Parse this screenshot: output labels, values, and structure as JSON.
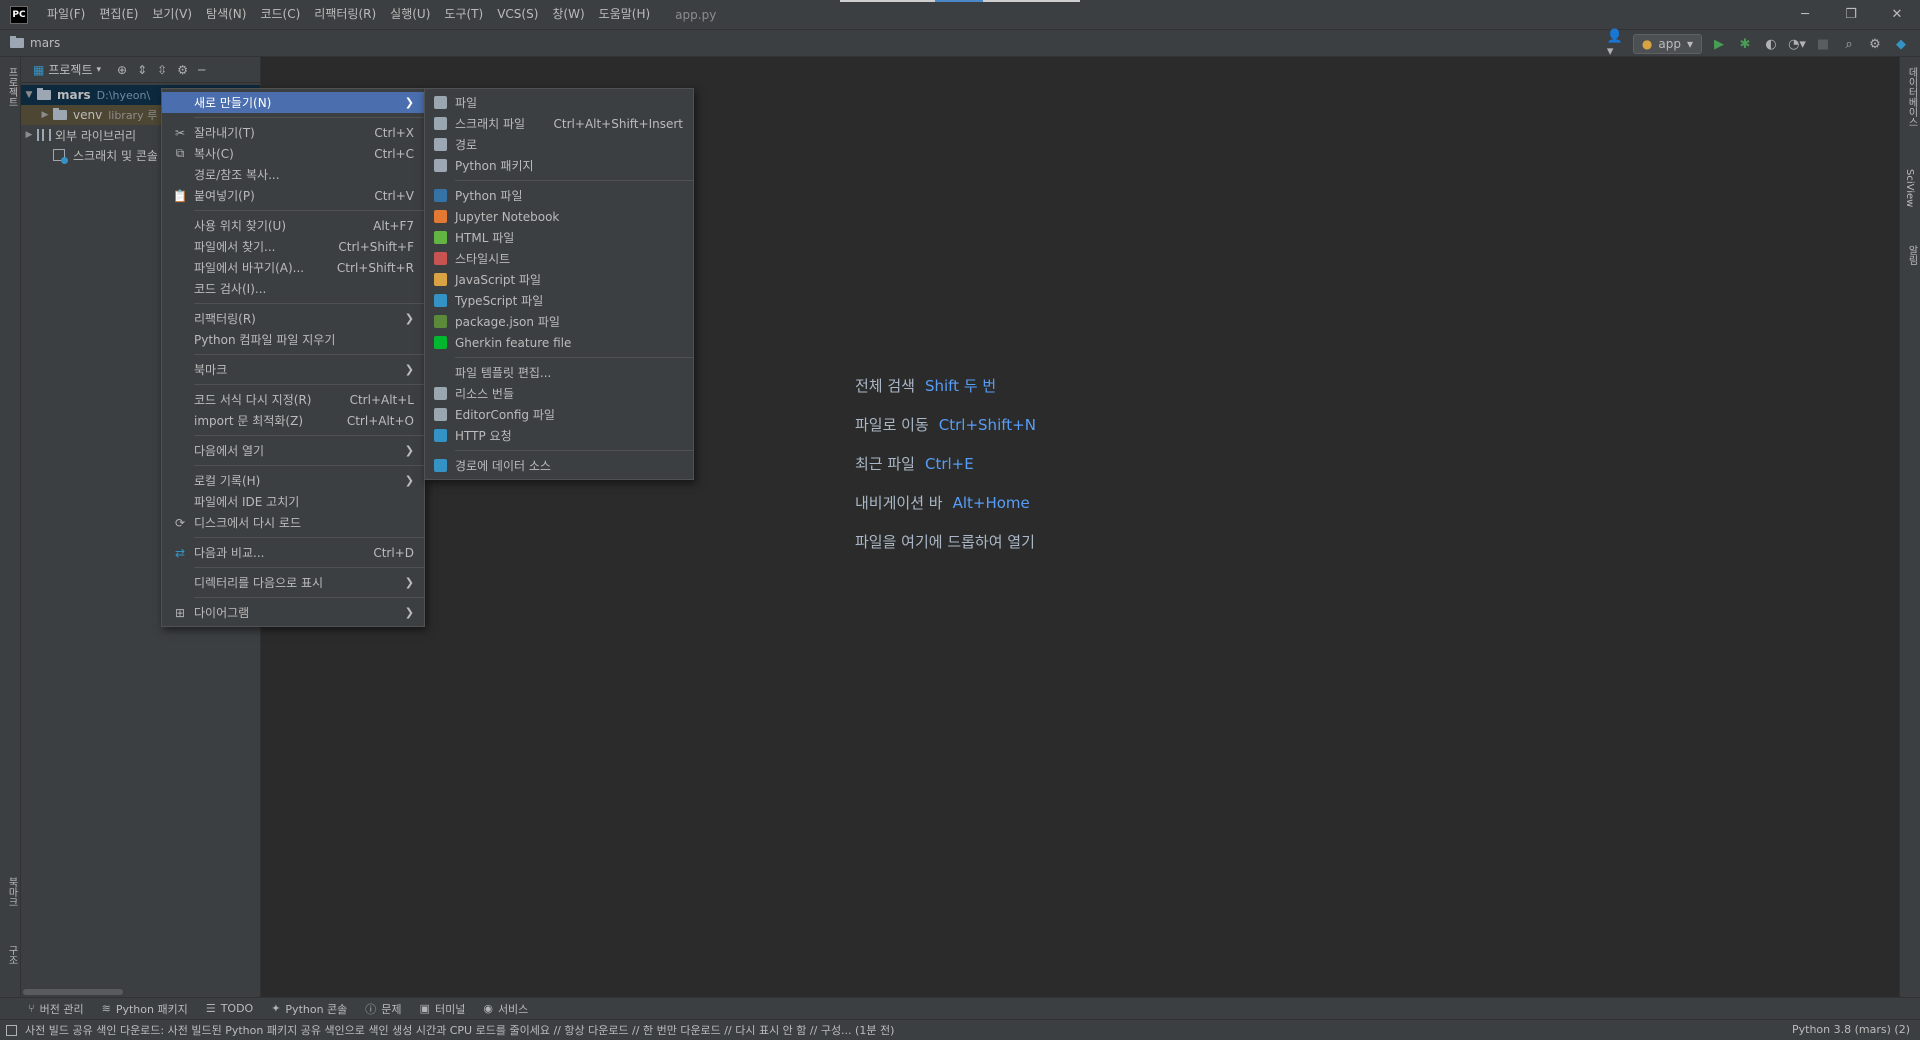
{
  "titlebar": {
    "logo": "PC",
    "menus": [
      "파일(F)",
      "편집(E)",
      "보기(V)",
      "탐색(N)",
      "코드(C)",
      "리팩터링(R)",
      "실행(U)",
      "도구(T)",
      "VCS(S)",
      "창(W)",
      "도움말(H)"
    ],
    "file_title": "app.py",
    "controls": [
      "─",
      "❐",
      "✕"
    ]
  },
  "navbar": {
    "breadcrumb": "mars",
    "run_config": "app"
  },
  "left_stripe": {
    "top_label": "프로젝트",
    "bookmark_label": "북마크",
    "structure_label": "구조"
  },
  "right_stripe": {
    "db_label": "데이터베이스",
    "sciview_label": "SciView",
    "notify_label": "알림"
  },
  "project_panel": {
    "title": "프로젝트",
    "tree": [
      {
        "name": "mars",
        "path": "D:\\hyeon\\"
      },
      {
        "name": "venv",
        "path": "library 루"
      },
      {
        "name": "외부 라이브러리",
        "path": ""
      },
      {
        "name": "스크래치 및 콘솔",
        "path": ""
      }
    ]
  },
  "editor_hints": [
    {
      "label": "전체 검색",
      "keys": "Shift 두 번"
    },
    {
      "label": "파일로 이동",
      "keys": "Ctrl+Shift+N"
    },
    {
      "label": "최근 파일",
      "keys": "Ctrl+E"
    },
    {
      "label": "내비게이션 바",
      "keys": "Alt+Home"
    },
    {
      "label": "파일을 여기에 드롭하여 열기",
      "keys": ""
    }
  ],
  "context_menu": {
    "new": "새로 만들기(N)",
    "cut": "잘라내기(T)",
    "cut_sc": "Ctrl+X",
    "copy": "복사(C)",
    "copy_sc": "Ctrl+C",
    "copy_path": "경로/참조 복사...",
    "paste": "붙여넣기(P)",
    "paste_sc": "Ctrl+V",
    "find_usages": "사용 위치 찾기(U)",
    "find_usages_sc": "Alt+F7",
    "find_in_files": "파일에서 찾기...",
    "find_in_files_sc": "Ctrl+Shift+F",
    "replace_in_files": "파일에서 바꾸기(A)...",
    "replace_in_files_sc": "Ctrl+Shift+R",
    "inspect": "코드 검사(I)...",
    "refactor": "리팩터링(R)",
    "clean_python": "Python 컴파일 파일 지우기",
    "bookmarks": "북마크",
    "reformat": "코드 서식 다시 지정(R)",
    "reformat_sc": "Ctrl+Alt+L",
    "optimize_imports": "import 문 최적화(Z)",
    "optimize_imports_sc": "Ctrl+Alt+O",
    "open_in": "다음에서 열기",
    "local_history": "로컬 기록(H)",
    "repair_ide": "파일에서 IDE 고치기",
    "reload": "디스크에서 다시 로드",
    "compare": "다음과 비교...",
    "compare_sc": "Ctrl+D",
    "mark_dir": "디렉터리를 다음으로 표시",
    "diagrams": "다이어그램"
  },
  "submenu": {
    "items": [
      {
        "label": "파일",
        "sc": "",
        "color": "#9aa7b0"
      },
      {
        "label": "스크래치 파일",
        "sc": "Ctrl+Alt+Shift+Insert",
        "color": "#9aa7b0"
      },
      {
        "label": "경로",
        "sc": "",
        "color": "#9da7b3"
      },
      {
        "label": "Python 패키지",
        "sc": "",
        "color": "#9da7b3"
      },
      {
        "label": "Python 파일",
        "sc": "",
        "color": "#3572a5"
      },
      {
        "label": "Jupyter Notebook",
        "sc": "",
        "color": "#e37933"
      },
      {
        "label": "HTML 파일",
        "sc": "",
        "color": "#62b543"
      },
      {
        "label": "스타일시트",
        "sc": "",
        "color": "#c75450"
      },
      {
        "label": "JavaScript 파일",
        "sc": "",
        "color": "#d9a343"
      },
      {
        "label": "TypeScript 파일",
        "sc": "",
        "color": "#3592c4"
      },
      {
        "label": "package.json 파일",
        "sc": "",
        "color": "#5a8a3a"
      },
      {
        "label": "Gherkin feature file",
        "sc": "",
        "color": "#00b72f"
      },
      {
        "label": "파일 템플릿 편집...",
        "sc": "",
        "color": ""
      },
      {
        "label": "리소스 번들",
        "sc": "",
        "color": "#9aa7b0"
      },
      {
        "label": "EditorConfig 파일",
        "sc": "",
        "color": "#9aa7b0"
      },
      {
        "label": "HTTP 요청",
        "sc": "",
        "color": "#3592c4"
      },
      {
        "label": "경로에 데이터 소스",
        "sc": "",
        "color": "#3592c4"
      }
    ]
  },
  "bottom_tools": [
    "버전 관리",
    "Python 패키지",
    "TODO",
    "Python 콘솔",
    "문제",
    "터미널",
    "서비스"
  ],
  "status": {
    "message": "사전 빌드 공유 색인 다운로드: 사전 빌드된 Python 패키지 공유 색인으로 색인 생성 시간과 CPU 로드를 줄이세요 // 항상 다운로드 // 한 번만 다운로드 // 다시 표시 안 함 // 구성... (1분 전)",
    "interpreter": "Python 3.8 (mars) (2)"
  }
}
